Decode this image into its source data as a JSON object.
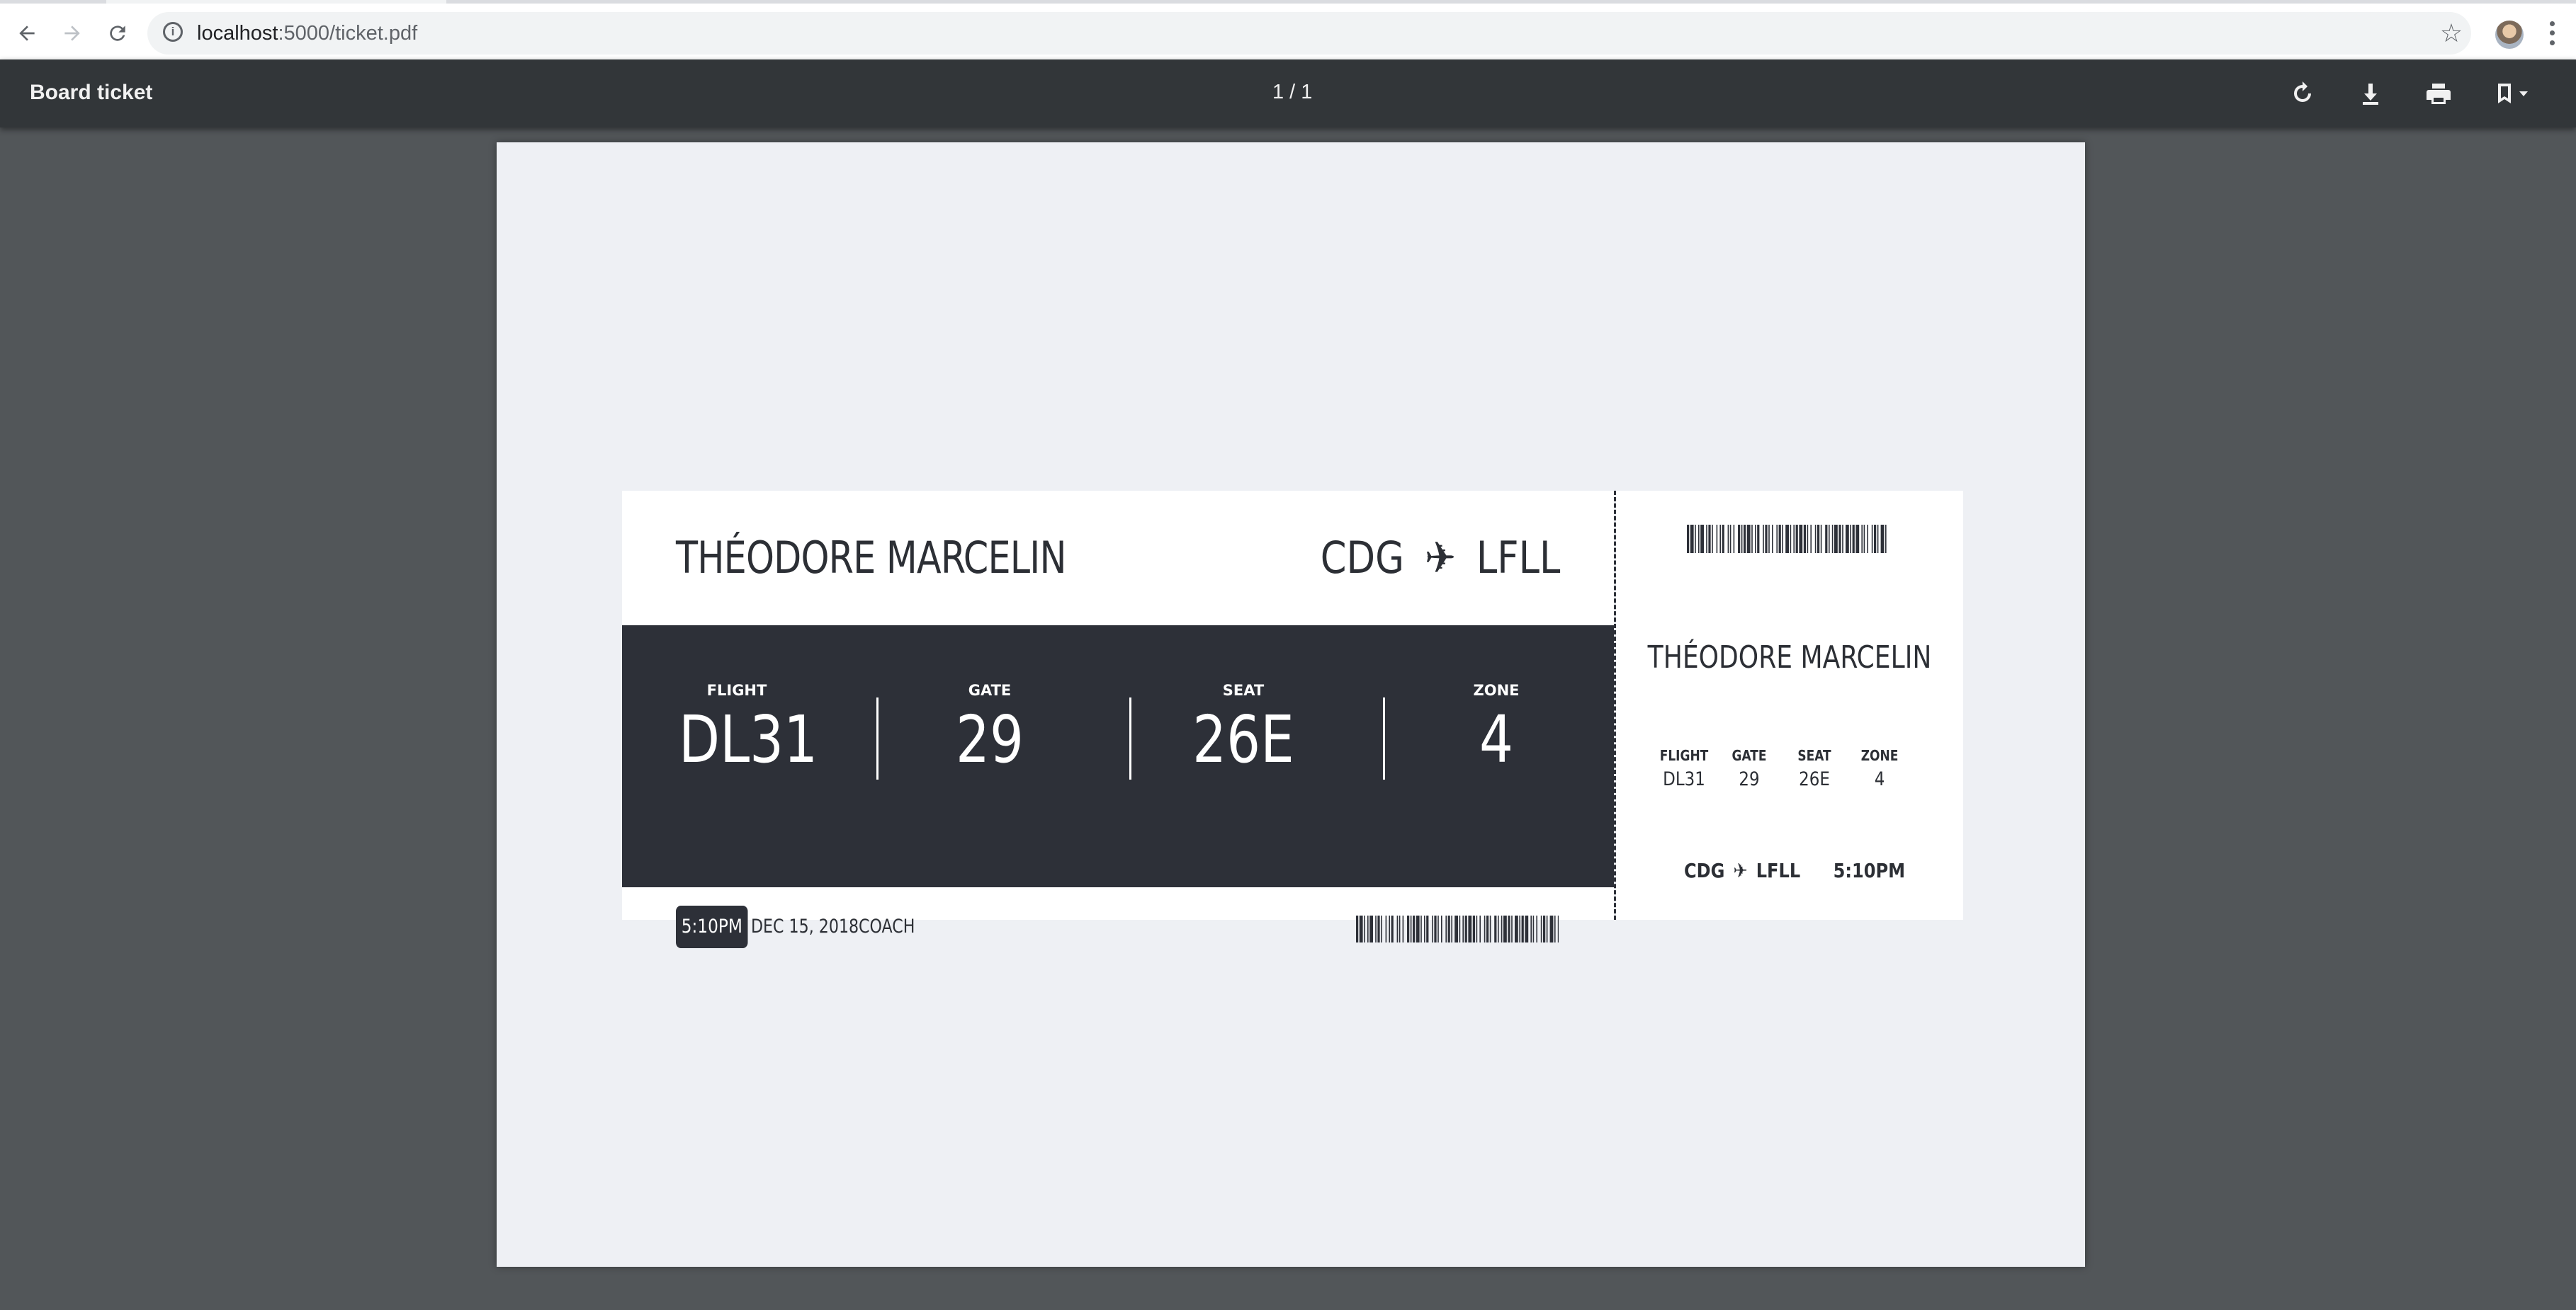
{
  "browser": {
    "url_host": "localhost",
    "url_path": ":5000/ticket.pdf"
  },
  "viewer": {
    "title": "Board ticket",
    "page_indicator": "1 / 1"
  },
  "ticket": {
    "passenger": "THÉODORE MARCELIN",
    "origin": "CDG",
    "destination": "LFLL",
    "fields": [
      {
        "label": "FLIGHT",
        "value": "DL31"
      },
      {
        "label": "GATE",
        "value": "29"
      },
      {
        "label": "SEAT",
        "value": "26E"
      },
      {
        "label": "ZONE",
        "value": "4"
      }
    ],
    "time": "5:10PM",
    "date": "DEC 15, 2018",
    "class": "COACH"
  },
  "colors": {
    "dark": "#2d3038",
    "page": "#eef0f4",
    "toolbar": "#323639",
    "viewer_bg": "#525659"
  },
  "icons": [
    "back-arrow-icon",
    "forward-arrow-icon",
    "reload-icon",
    "info-icon",
    "star-icon",
    "kebab-menu-icon",
    "rotate-icon",
    "download-icon",
    "print-icon",
    "bookmark-icon",
    "airplane-icon",
    "barcode-icon"
  ]
}
